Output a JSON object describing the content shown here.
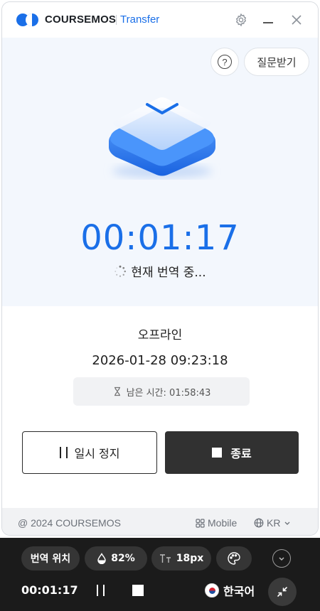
{
  "window": {
    "brand": "COURSEMOS",
    "brand_sub": "Transfer"
  },
  "hero": {
    "ask_label": "질문받기",
    "help_label": "?",
    "timer": "00:01:17",
    "status": "현재 번역 중..."
  },
  "session": {
    "title": "오프라인",
    "datetime": "2026-01-28 09:23:18",
    "remaining": "남은 시간: 01:58:43"
  },
  "controls": {
    "pause_label": "일시 정지",
    "stop_label": "종료"
  },
  "footer": {
    "copyright": "@ 2024 COURSEMOS",
    "mobile_label": "Mobile",
    "lang_label": "KR"
  },
  "bar": {
    "position_label": "번역 위치",
    "opacity_label": "82%",
    "font_size_label": "18px",
    "elapsed": "00:01:17",
    "language": "한국어"
  },
  "colors": {
    "accent": "#1a6fe8",
    "dark_button": "#313131",
    "bar_bg": "#1b1b1b"
  },
  "icons": [
    "gear-icon",
    "minimize-icon",
    "close-icon",
    "help-icon",
    "spinner-icon",
    "hourglass-icon",
    "pause-icon",
    "stop-icon",
    "grid-icon",
    "globe-icon",
    "chevron-down-icon",
    "opacity-icon",
    "text-size-icon",
    "palette-icon",
    "collapse-icon",
    "korea-flag-icon",
    "shrink-icon"
  ]
}
